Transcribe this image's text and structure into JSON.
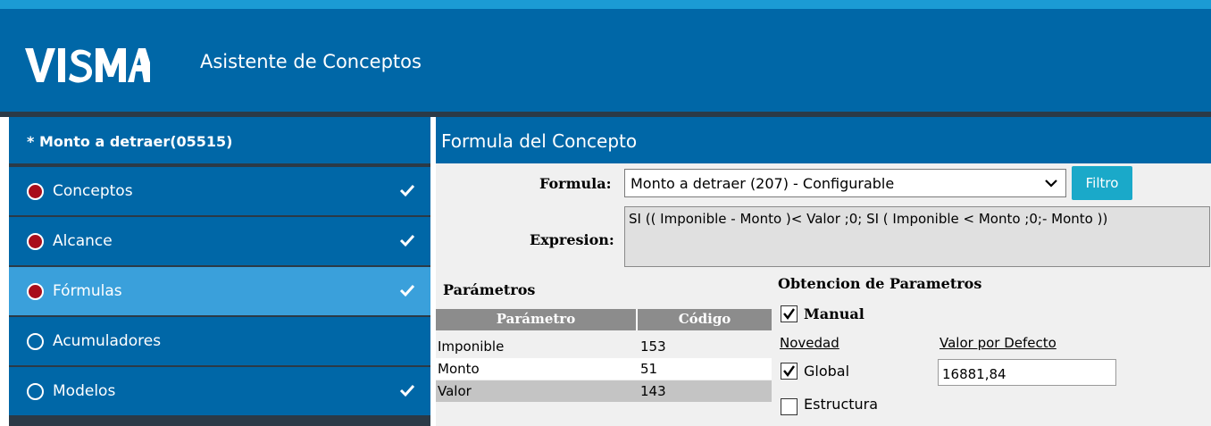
{
  "header": {
    "brand": "VISMA",
    "title": "Asistente de Conceptos",
    "colors": {
      "primary": "#0067a7",
      "accent": "#1b9bd4",
      "active": "#3aa0db"
    }
  },
  "sidebar": {
    "heading": "* Monto a detraer(05515)",
    "items": [
      {
        "label": "Conceptos",
        "status": "filled",
        "checked": true
      },
      {
        "label": "Alcance",
        "status": "filled",
        "checked": true
      },
      {
        "label": "Fórmulas",
        "status": "filled",
        "checked": true,
        "active": true
      },
      {
        "label": "Acumuladores",
        "status": "empty",
        "checked": false
      },
      {
        "label": "Modelos",
        "status": "empty",
        "checked": true
      }
    ]
  },
  "panel": {
    "title": "Formula del Concepto",
    "formula_label": "Formula:",
    "formula_value": "Monto a detraer (207) - Configurable",
    "filter_button": "Filtro",
    "expression_label": "Expresion:",
    "expression_value": "SI (( Imponible - Monto )< Valor ;0; SI ( Imponible < Monto ;0;- Monto ))"
  },
  "parametros": {
    "title": "Parámetros",
    "columns": [
      "Parámetro",
      "Código"
    ],
    "rows": [
      {
        "name": "Imponible",
        "code": "153"
      },
      {
        "name": "Monto",
        "code": "51"
      },
      {
        "name": "Valor",
        "code": "143"
      }
    ]
  },
  "obtencion": {
    "title": "Obtencion de Parametros",
    "manual_label": "Manual",
    "manual_checked": true,
    "novedad_label": "Novedad",
    "valor_defecto_label": "Valor por Defecto",
    "global_label": "Global",
    "global_checked": true,
    "valor_defecto_value": "16881,84",
    "estructura_label": "Estructura",
    "estructura_checked": false
  }
}
